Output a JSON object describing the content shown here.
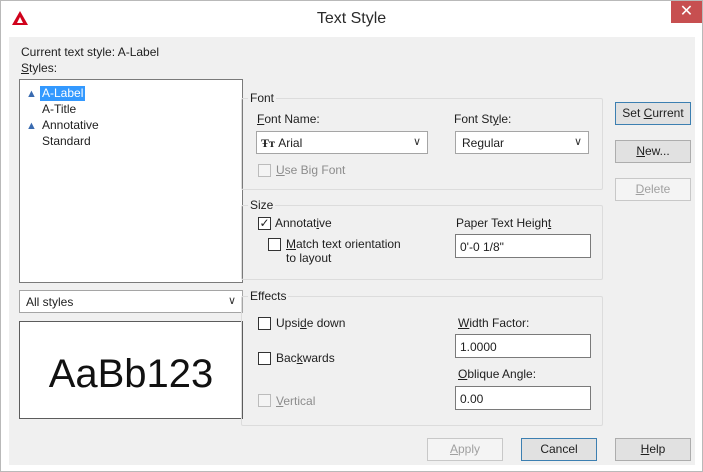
{
  "window": {
    "title": "Text Style",
    "close_glyph": "✕",
    "app_icon": "autocad-logo-icon"
  },
  "current_style": {
    "label": "Current text style:",
    "value": "A-Label"
  },
  "styles": {
    "label": "Styles:",
    "items": [
      {
        "name": "A-Label",
        "annotative": true,
        "selected": true
      },
      {
        "name": "A-Title",
        "annotative": false,
        "selected": false
      },
      {
        "name": "Annotative",
        "annotative": true,
        "selected": false
      },
      {
        "name": "Standard",
        "annotative": false,
        "selected": false
      }
    ],
    "filter_value": "All styles",
    "preview_text": "AaBb123"
  },
  "font": {
    "group_title": "Font",
    "name_label": "Font Name:",
    "name_value": "Arial",
    "name_icon": "truetype-font-icon",
    "style_label": "Font Style:",
    "style_value": "Regular",
    "big_font_label": "Use Big Font",
    "big_font_checked": false
  },
  "size": {
    "group_title": "Size",
    "annotative_label": "Annotative",
    "annotative_checked": true,
    "match_label_line1": "Match text orientation",
    "match_label_line2": "to layout",
    "match_checked": false,
    "paper_height_label": "Paper Text Height",
    "paper_height_value": "0'-0 1/8\""
  },
  "effects": {
    "group_title": "Effects",
    "upside_down_label": "Upside down",
    "backwards_label": "Backwards",
    "vertical_label": "Vertical",
    "width_factor_label": "Width Factor:",
    "width_factor_value": "1.0000",
    "oblique_label": "Oblique Angle:",
    "oblique_value": "0.00"
  },
  "buttons": {
    "set_current": "Set Current",
    "new": "New...",
    "delete": "Delete",
    "apply": "Apply",
    "cancel": "Cancel",
    "help": "Help"
  },
  "colors": {
    "selection": "#3399ff",
    "close": "#c74f50",
    "annotative_mark": "#3a6bb0"
  }
}
